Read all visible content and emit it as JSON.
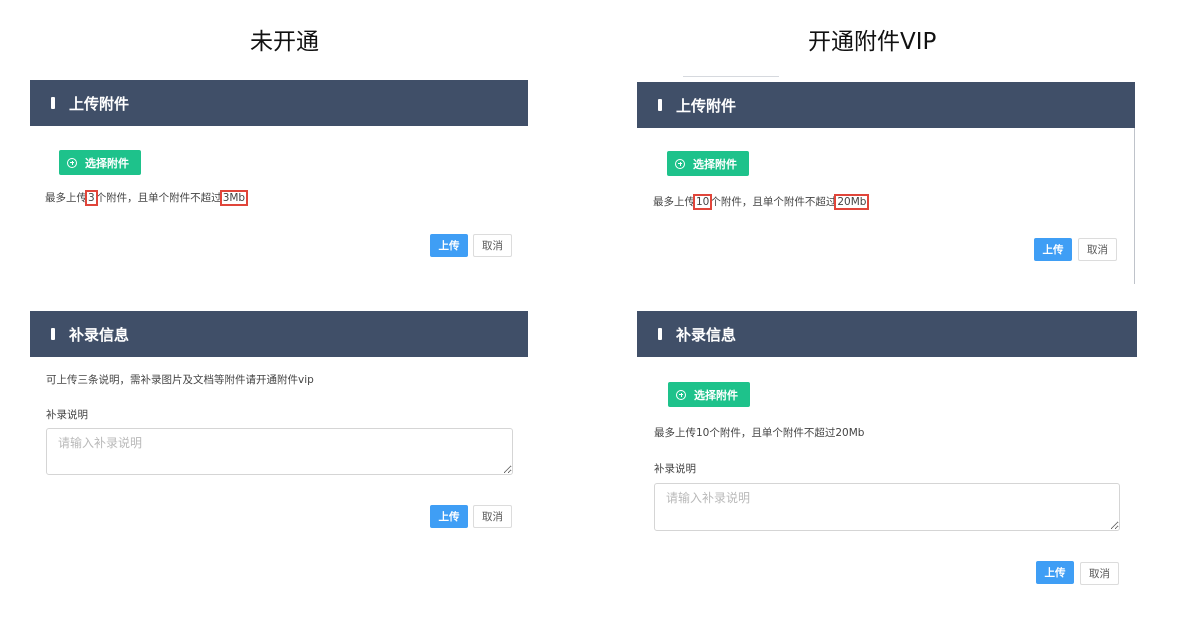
{
  "left": {
    "column_title": "未开通",
    "upload_panel": {
      "title": "上传附件",
      "select_button": "选择附件",
      "limit_prefix": "最多上传",
      "limit_count": "3",
      "limit_middle": "个附件，且单个附件不超过",
      "limit_size": "3Mb",
      "upload_button": "上传",
      "cancel_button": "取消"
    },
    "supplement_panel": {
      "title": "补录信息",
      "notice": "可上传三条说明，需补录图片及文档等附件请开通附件vip",
      "field_label": "补录说明",
      "placeholder": "请输入补录说明",
      "upload_button": "上传",
      "cancel_button": "取消"
    }
  },
  "right": {
    "column_title": "开通附件VIP",
    "upload_panel": {
      "title": "上传附件",
      "select_button": "选择附件",
      "limit_prefix": "最多上传",
      "limit_count": "10",
      "limit_middle": "个附件，且单个附件不超过",
      "limit_size": "20Mb",
      "upload_button": "上传",
      "cancel_button": "取消"
    },
    "supplement_panel": {
      "title": "补录信息",
      "select_button": "选择附件",
      "limit_text": "最多上传10个附件，且单个附件不超过20Mb",
      "field_label": "补录说明",
      "placeholder": "请输入补录说明",
      "upload_button": "上传",
      "cancel_button": "取消"
    }
  },
  "colors": {
    "header_bg": "#404f68",
    "select_btn": "#1ec28b",
    "upload_btn": "#3f9ef5",
    "highlight": "#e0453a"
  },
  "icons": [
    "plus-circle-icon"
  ]
}
